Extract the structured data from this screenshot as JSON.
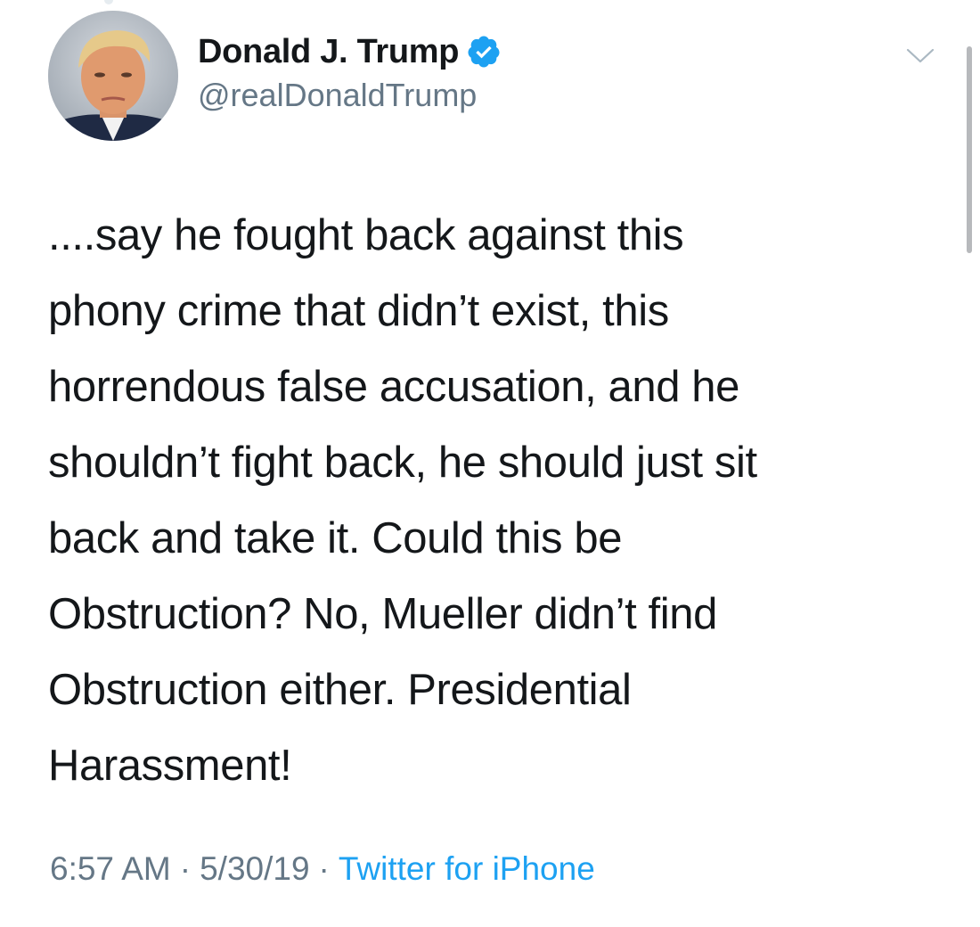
{
  "tweet": {
    "author": {
      "display_name": "Donald J. Trump",
      "handle": "@realDonaldTrump",
      "verified": true
    },
    "text_lines": [
      "....say he fought back against this",
      "phony crime that didn’t exist, this",
      "horrendous false accusation, and he",
      "shouldn’t fight back, he should just sit",
      "back and take it. Could this be",
      "Obstruction? No, Mueller didn’t find",
      "Obstruction either. Presidential",
      "Harassment!"
    ],
    "meta": {
      "time": "6:57 AM",
      "separator": "·",
      "date": "5/30/19",
      "source": "Twitter for iPhone"
    }
  },
  "icons": {
    "verified": "verified-badge-icon",
    "more": "chevron-down-icon"
  },
  "colors": {
    "verified_blue": "#1da1f2",
    "link_blue": "#1da1f2",
    "secondary_text": "#657786",
    "primary_text": "#14171a",
    "background": "#ffffff"
  }
}
